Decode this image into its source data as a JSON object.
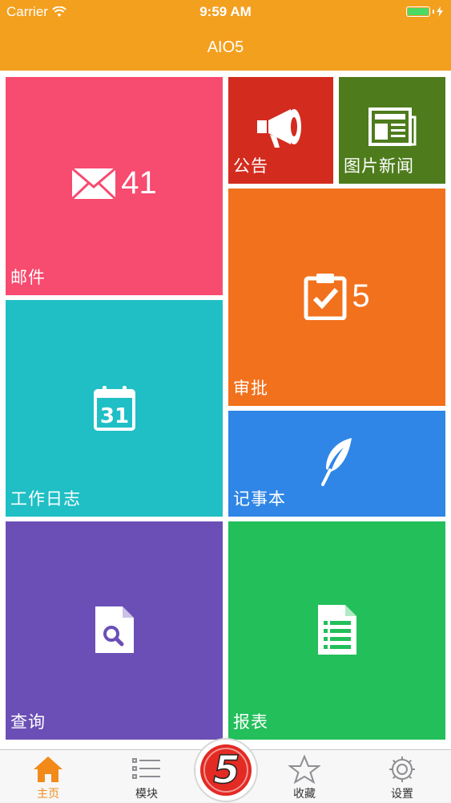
{
  "status_bar": {
    "carrier": "Carrier",
    "time": "9:59 AM",
    "wifi_icon": "wifi-icon",
    "battery_icon": "battery-icon"
  },
  "nav": {
    "title": "AIO5"
  },
  "tiles": {
    "mail": {
      "label": "邮件",
      "count": "41",
      "color": "#f74b6f",
      "icon": "envelope-icon"
    },
    "announcement": {
      "label": "公告",
      "color": "#d42b1f",
      "icon": "megaphone-icon"
    },
    "photo_news": {
      "label": "图片新闻",
      "color": "#4e7c1c",
      "icon": "newspaper-icon"
    },
    "approval": {
      "label": "审批",
      "count": "5",
      "color": "#f2711d",
      "icon": "clipboard-check-icon"
    },
    "work_log": {
      "label": "工作日志",
      "color": "#1fbfc5",
      "icon": "calendar-icon",
      "calendar_day": "31"
    },
    "notebook": {
      "label": "记事本",
      "color": "#2f86e6",
      "icon": "feather-icon"
    },
    "query": {
      "label": "查询",
      "color": "#6b4fb6",
      "icon": "search-document-icon"
    },
    "report": {
      "label": "报表",
      "color": "#22bf5a",
      "icon": "report-document-icon"
    }
  },
  "tab_bar": {
    "active_color": "#f28a1a",
    "tabs": [
      {
        "label": "主页",
        "icon": "home-icon",
        "active": true
      },
      {
        "label": "模块",
        "icon": "list-icon",
        "active": false
      },
      {
        "label": "收藏",
        "icon": "star-icon",
        "active": false
      },
      {
        "label": "设置",
        "icon": "gear-icon",
        "active": false
      }
    ],
    "center_logo": {
      "text": "5",
      "icon": "logo-5-icon"
    }
  }
}
